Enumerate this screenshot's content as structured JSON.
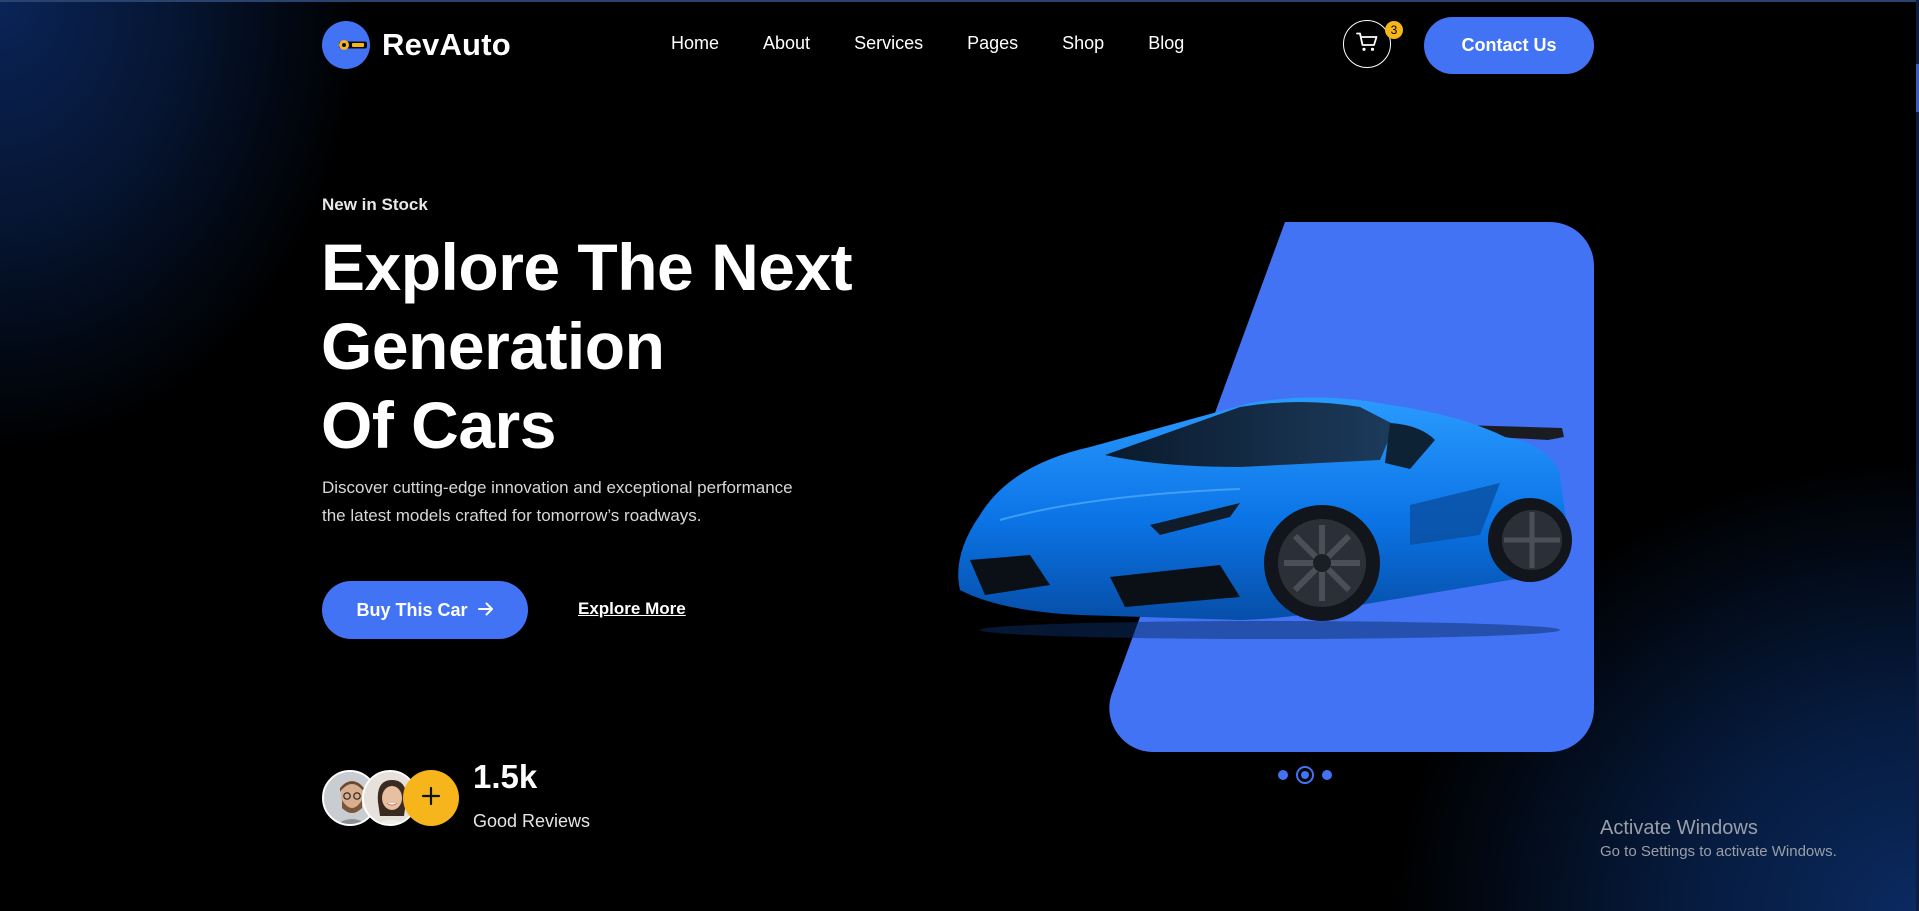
{
  "brand": {
    "name": "RevAuto",
    "accent": "#4273f5",
    "highlight": "#f5b51b"
  },
  "nav": [
    {
      "label": "Home"
    },
    {
      "label": "About"
    },
    {
      "label": "Services"
    },
    {
      "label": "Pages"
    },
    {
      "label": "Shop"
    },
    {
      "label": "Blog"
    }
  ],
  "cart": {
    "icon": "cart-icon",
    "count": "3"
  },
  "contact_label": "Contact Us",
  "hero": {
    "eyebrow": "New in Stock",
    "title_lines": [
      "Explore The Next",
      "Generation",
      "Of Cars"
    ],
    "description_lines": [
      "Discover cutting-edge innovation and exceptional performance",
      "the latest models crafted for tomorrow’s roadways."
    ],
    "buy_label": "Buy This Car",
    "buy_icon": "arrow-right-icon",
    "explore_label": "Explore More"
  },
  "reviews": {
    "count": "1.5k",
    "label": "Good Reviews",
    "plus_icon": "plus-icon"
  },
  "slider": {
    "dots": 3,
    "active": 2
  },
  "watermark": {
    "title": "Activate Windows",
    "subtitle": "Go to Settings to activate Windows."
  }
}
